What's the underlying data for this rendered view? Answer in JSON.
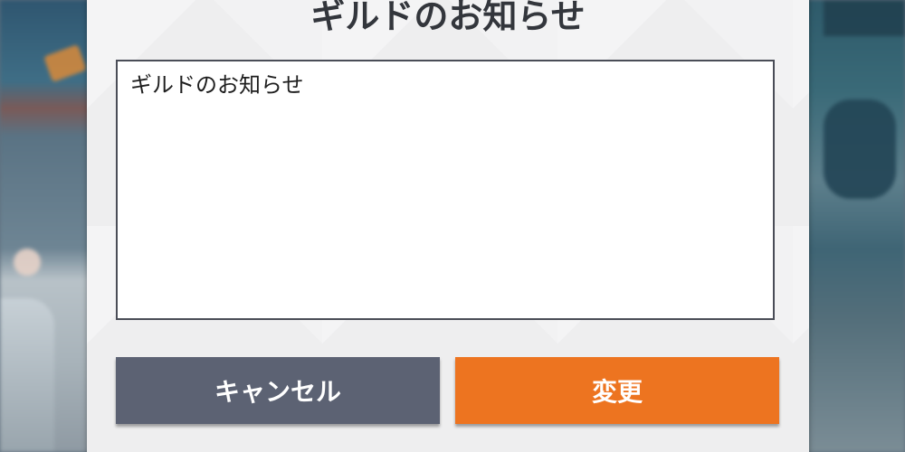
{
  "dialog": {
    "title": "ギルドのお知らせ",
    "notice_text": "ギルドのお知らせ",
    "cancel_label": "キャンセル",
    "confirm_label": "変更"
  },
  "colors": {
    "cancel_button": "#5c6273",
    "confirm_button": "#ed7420",
    "dialog_background": "#eeeeef",
    "title_text": "#33363c"
  }
}
